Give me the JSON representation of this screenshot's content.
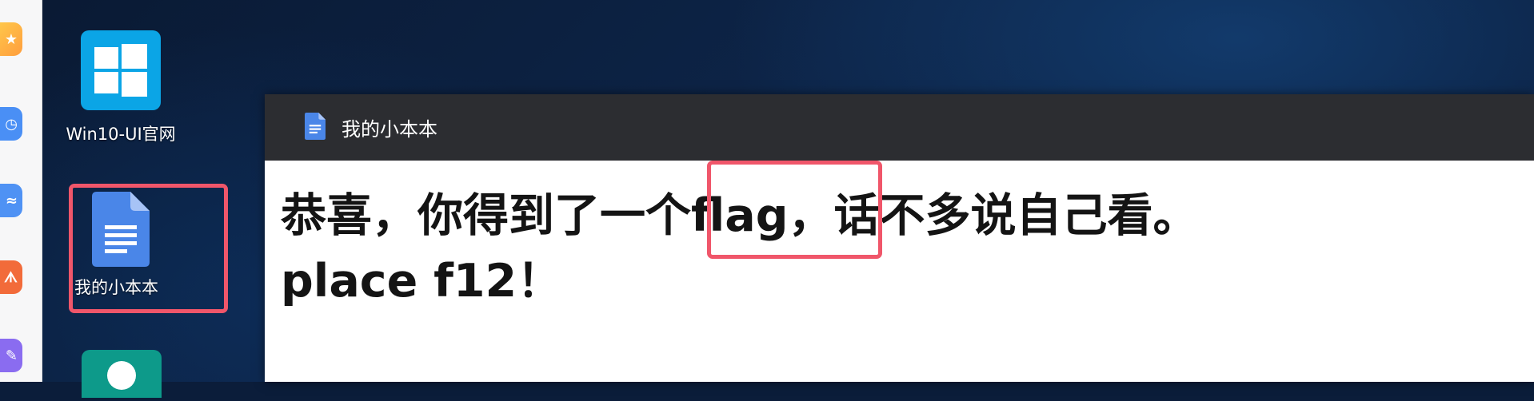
{
  "sidebar": {
    "icons": [
      {
        "name": "star-app-icon",
        "color": "#ffb23d",
        "glyph": "★"
      },
      {
        "name": "clock-app-icon",
        "color": "#4a8ff5",
        "glyph": "◷"
      },
      {
        "name": "chart-app-icon",
        "color": "#4f92f4",
        "glyph": "≈"
      },
      {
        "name": "pdf-app-icon",
        "color": "#f26b3a",
        "glyph": "ᗑ"
      },
      {
        "name": "edit-app-icon",
        "color": "#8a6cf0",
        "glyph": "✎"
      }
    ]
  },
  "desktop": {
    "icons": [
      {
        "label": "Win10-UI官网",
        "icon": "windows-logo-icon",
        "color": "#0ba5e6"
      },
      {
        "label": "我的小本本",
        "icon": "google-docs-icon",
        "color": "#4285f4",
        "selected": true
      },
      {
        "label": "",
        "icon": "user-avatar-icon",
        "color": "#0d9a8a"
      }
    ]
  },
  "window": {
    "title": "我的小本本",
    "title_icon": "google-docs-icon",
    "content": {
      "line1": "恭喜，你得到了一个flag，话不多说自己看。",
      "line2": "place f12！"
    }
  },
  "colors": {
    "highlight": "#f0566a",
    "titlebar": "#2c2d31"
  }
}
